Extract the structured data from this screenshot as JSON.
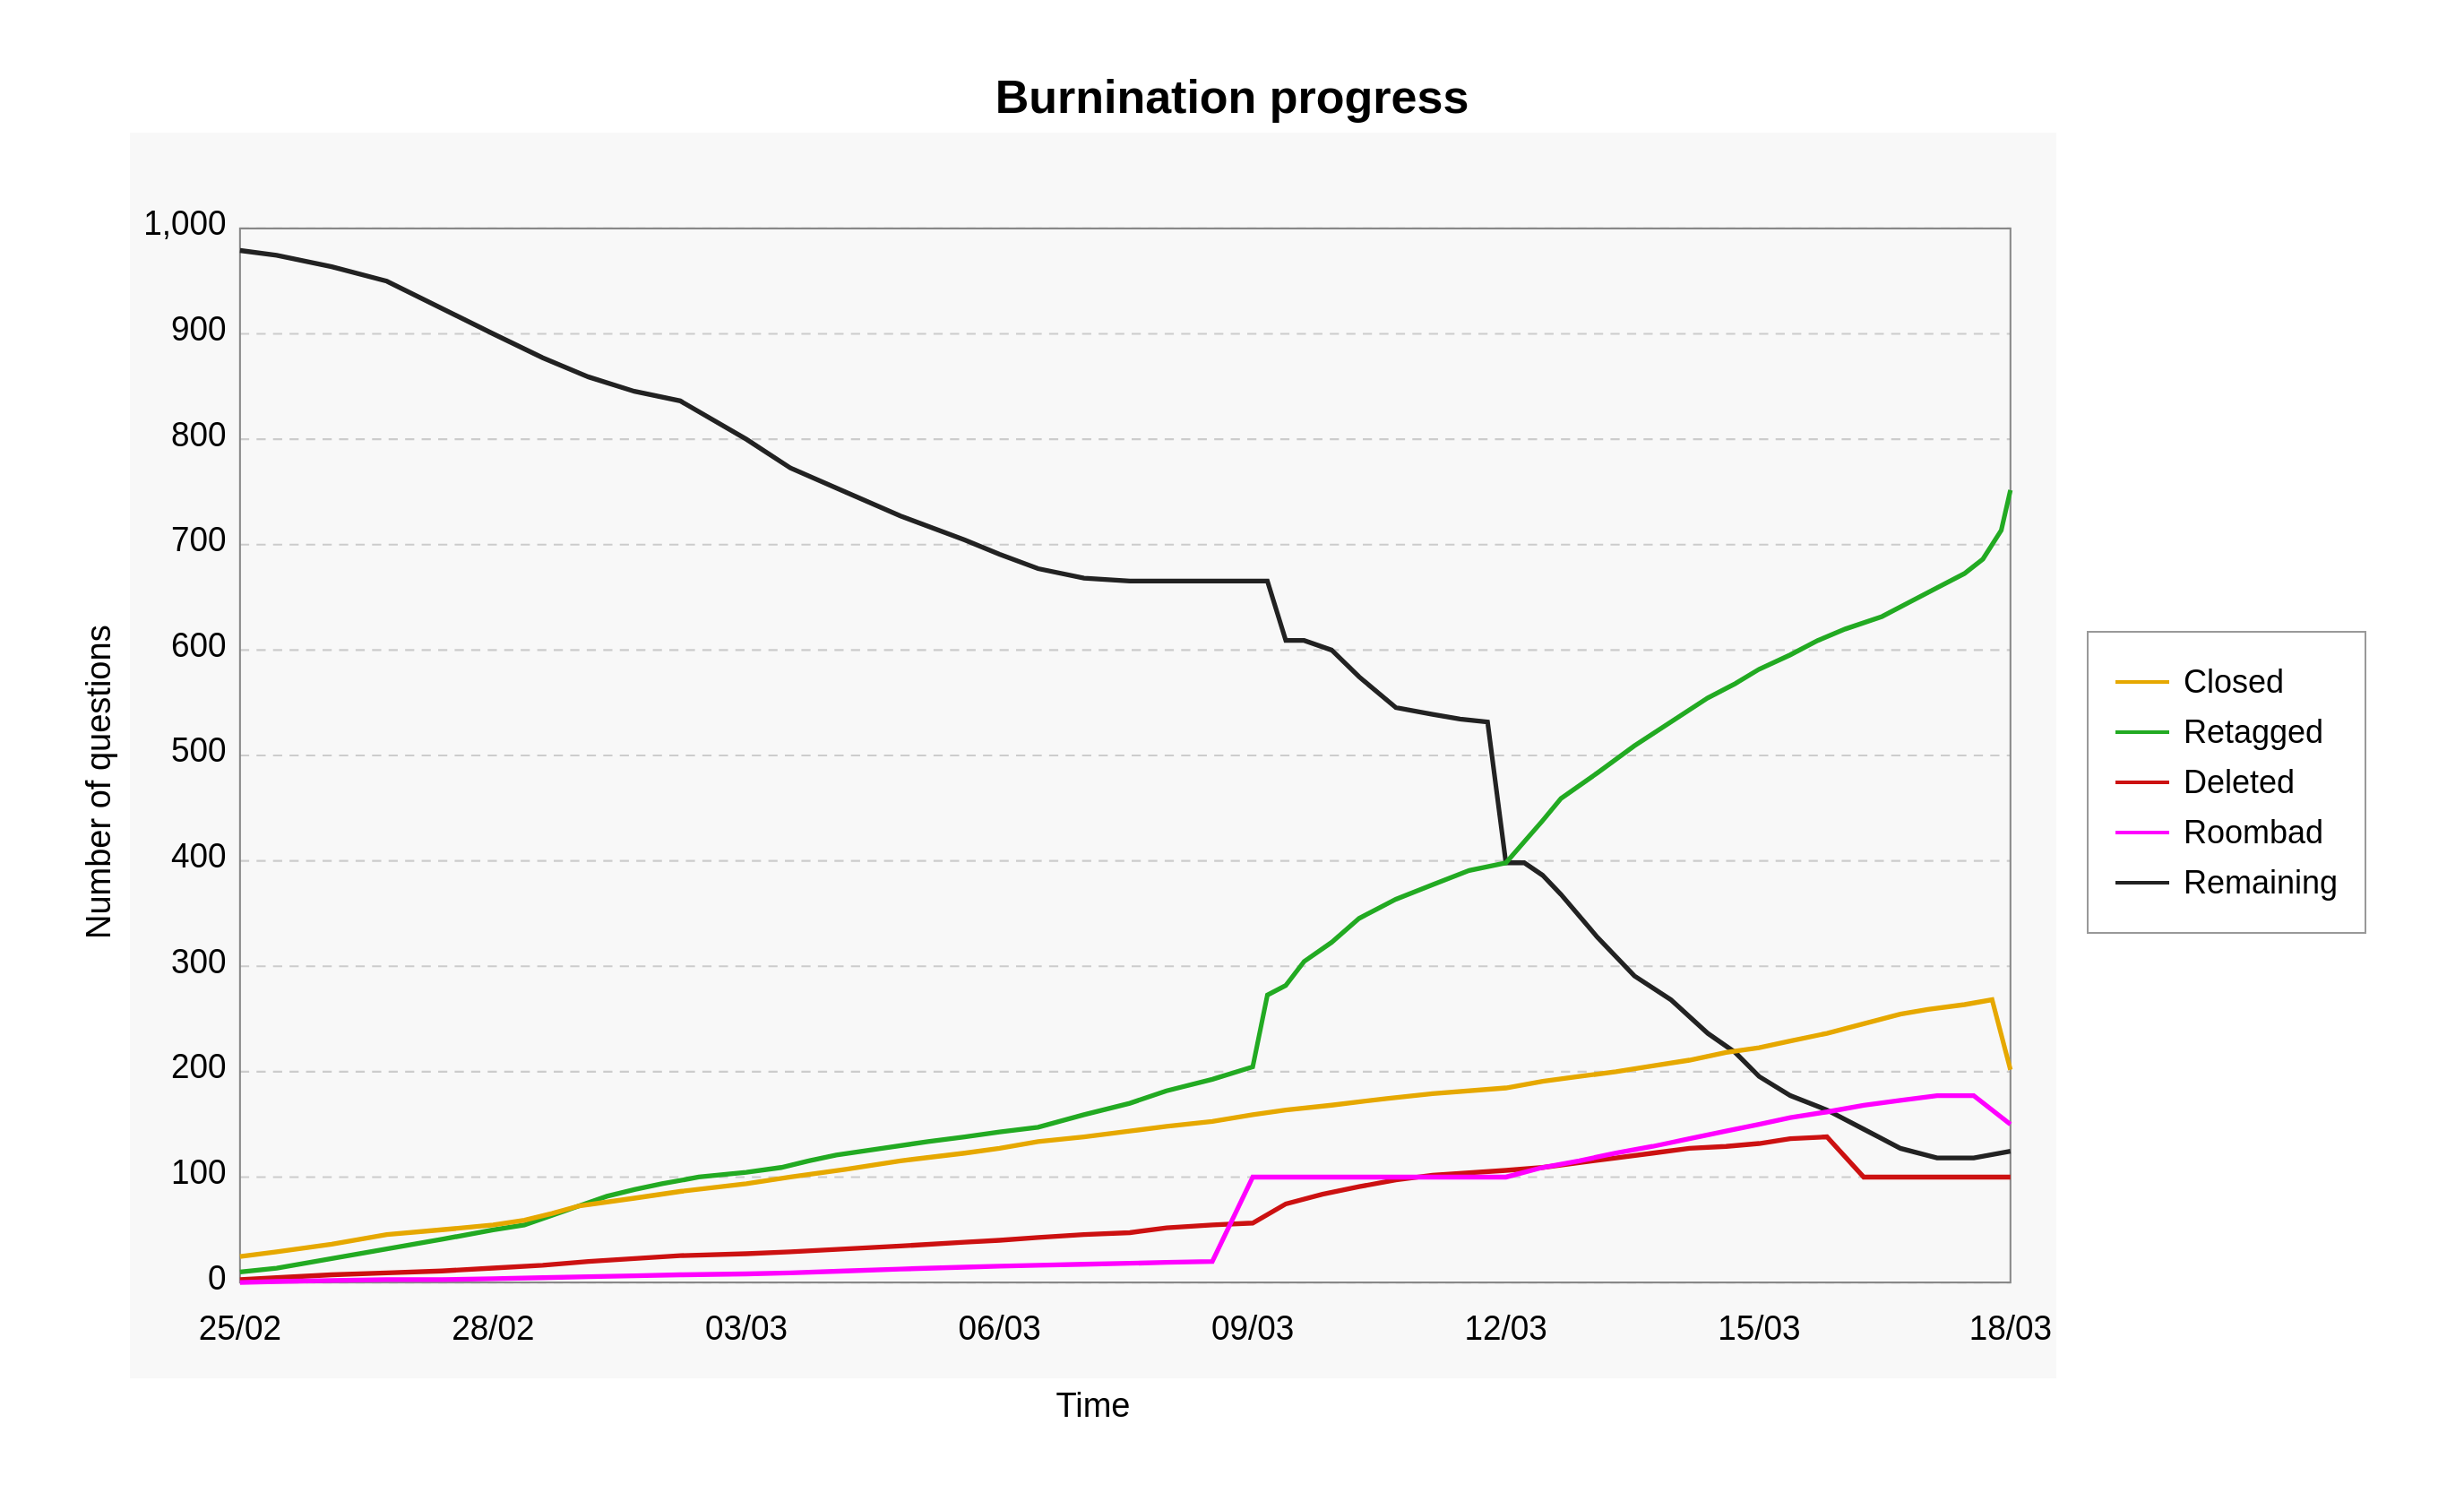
{
  "title": "Burnination progress",
  "y_axis_label": "Number of questions",
  "x_axis_label": "Time",
  "legend": {
    "items": [
      {
        "label": "Closed",
        "color": "#E6A800"
      },
      {
        "label": "Retagged",
        "color": "#22AA22"
      },
      {
        "label": "Deleted",
        "color": "#CC1111"
      },
      {
        "label": "Roombad",
        "color": "#FF00FF"
      },
      {
        "label": "Remaining",
        "color": "#222222"
      }
    ]
  },
  "y_axis": {
    "ticks": [
      0,
      100,
      200,
      300,
      400,
      500,
      600,
      700,
      800,
      900,
      1000
    ],
    "tick_labels": [
      "0",
      "100",
      "200",
      "300",
      "400",
      "500",
      "600",
      "700",
      "800",
      "900",
      "1,000"
    ]
  },
  "x_axis": {
    "ticks": [
      "25/02",
      "28/02",
      "03/03",
      "06/03",
      "09/03",
      "12/03",
      "15/03",
      "18/03"
    ]
  }
}
